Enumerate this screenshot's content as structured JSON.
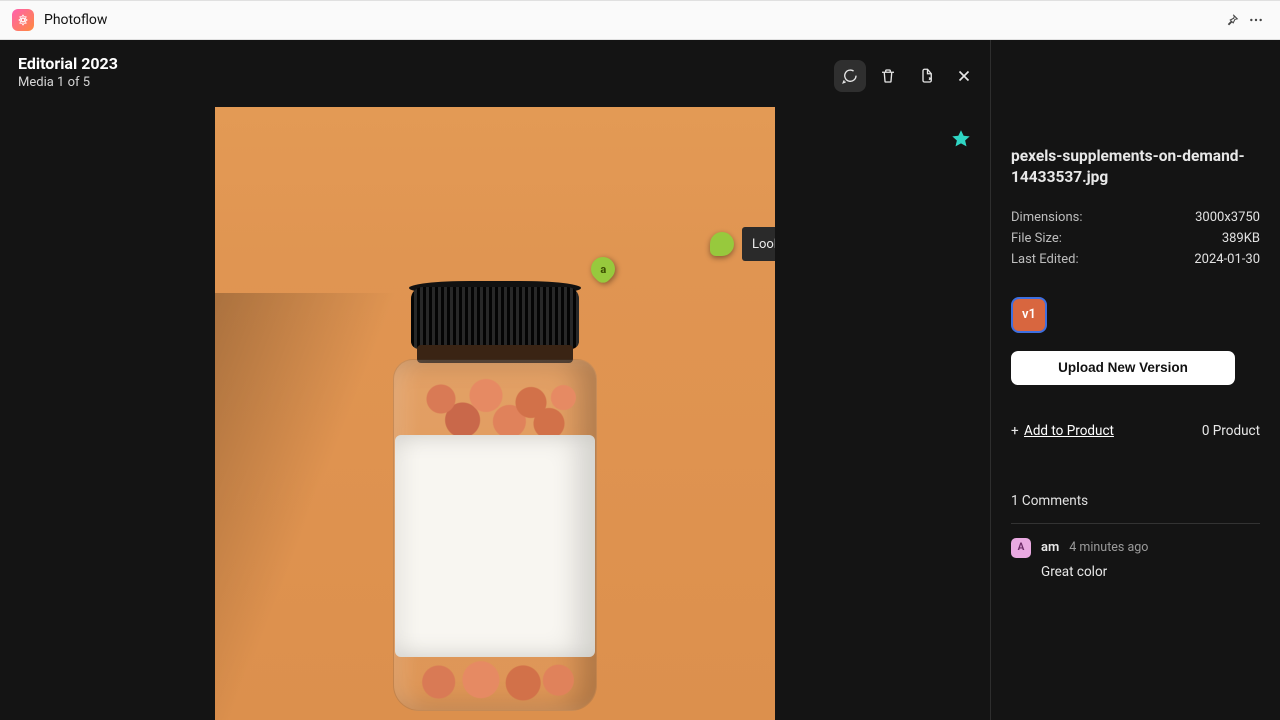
{
  "app": {
    "name": "Photoflow"
  },
  "header": {
    "title": "Editorial 2023",
    "subtitle": "Media 1 of 5"
  },
  "annotations": {
    "pin_label": "a",
    "comment_draft": "Looks great!"
  },
  "sidebar": {
    "filename": "pexels-supplements-on-demand-14433537.jpg",
    "meta": {
      "dimensions_label": "Dimensions:",
      "dimensions_value": "3000x3750",
      "filesize_label": "File Size:",
      "filesize_value": "389KB",
      "lastedited_label": "Last Edited:",
      "lastedited_value": "2024-01-30"
    },
    "version_label": "v1",
    "upload_button": "Upload New Version",
    "add_to_product_prefix": "+ ",
    "add_to_product_label": "Add to Product",
    "product_count": "0 Product",
    "comments_header": "1 Comments",
    "comments": [
      {
        "avatar": "A",
        "author": "am",
        "time": "4 minutes ago",
        "text": "Great color"
      }
    ]
  }
}
